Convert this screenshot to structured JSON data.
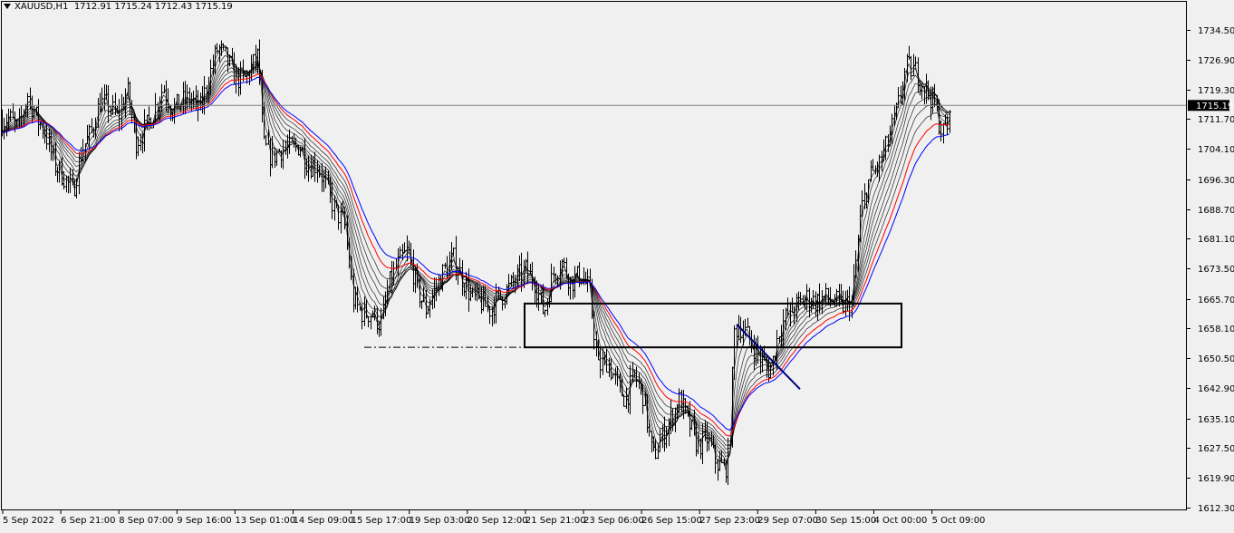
{
  "header": {
    "symbol_timeframe": "XAUUSD,H1",
    "ohlc": "1712.91 1715.24 1712.43 1715.19"
  },
  "chart_data": {
    "type": "line",
    "title": "XAUUSD,H1",
    "xlabel": "",
    "ylabel": "",
    "ylim": [
      1612.32,
      1740.68
    ],
    "grid": false,
    "current_price": "1715.19",
    "colors": {
      "bars": "#000000",
      "ema_fast": "#000000",
      "ema_mid": "#ff0000",
      "ema_slow": "#0000ff",
      "price_line": "#808080",
      "background": "#f0f0f0"
    },
    "y_ticks": [
      "1734.50",
      "1726.90",
      "1719.30",
      "1711.70",
      "1704.10",
      "1696.30",
      "1688.70",
      "1681.10",
      "1673.50",
      "1665.70",
      "1658.10",
      "1650.50",
      "1642.90",
      "1635.10",
      "1627.50",
      "1619.90",
      "1612.30"
    ],
    "x_ticks": [
      "5 Sep 2022",
      "6 Sep 21:00",
      "8 Sep 07:00",
      "9 Sep 16:00",
      "13 Sep 01:00",
      "14 Sep 09:00",
      "15 Sep 17:00",
      "19 Sep 03:00",
      "20 Sep 12:00",
      "21 Sep 21:00",
      "23 Sep 06:00",
      "26 Sep 15:00",
      "27 Sep 23:00",
      "29 Sep 07:00",
      "30 Sep 15:00",
      "4 Oct 00:00",
      "5 Oct 09:00"
    ],
    "price_path": [
      [
        0,
        1711
      ],
      [
        10,
        1712
      ],
      [
        20,
        1709
      ],
      [
        30,
        1718
      ],
      [
        40,
        1712
      ],
      [
        50,
        1708
      ],
      [
        60,
        1700
      ],
      [
        70,
        1697
      ],
      [
        80,
        1693
      ],
      [
        90,
        1704
      ],
      [
        100,
        1708
      ],
      [
        110,
        1716
      ],
      [
        120,
        1715
      ],
      [
        130,
        1712
      ],
      [
        140,
        1719
      ],
      [
        150,
        1706
      ],
      [
        160,
        1709
      ],
      [
        170,
        1714
      ],
      [
        180,
        1720
      ],
      [
        190,
        1714
      ],
      [
        200,
        1716
      ],
      [
        210,
        1717
      ],
      [
        220,
        1714
      ],
      [
        230,
        1722
      ],
      [
        240,
        1730
      ],
      [
        250,
        1727
      ],
      [
        260,
        1722
      ],
      [
        270,
        1722
      ],
      [
        280,
        1726
      ],
      [
        285,
        1728
      ],
      [
        290,
        1705
      ],
      [
        300,
        1702
      ],
      [
        310,
        1704
      ],
      [
        320,
        1704
      ],
      [
        330,
        1705
      ],
      [
        340,
        1700
      ],
      [
        350,
        1700
      ],
      [
        360,
        1694
      ],
      [
        370,
        1688
      ],
      [
        380,
        1685
      ],
      [
        390,
        1665
      ],
      [
        400,
        1662
      ],
      [
        410,
        1662
      ],
      [
        420,
        1659
      ],
      [
        430,
        1670
      ],
      [
        440,
        1675
      ],
      [
        450,
        1678
      ],
      [
        460,
        1668
      ],
      [
        470,
        1663
      ],
      [
        480,
        1668
      ],
      [
        490,
        1673
      ],
      [
        500,
        1676
      ],
      [
        510,
        1671
      ],
      [
        520,
        1666
      ],
      [
        530,
        1665
      ],
      [
        540,
        1663
      ],
      [
        550,
        1666
      ],
      [
        560,
        1668
      ],
      [
        570,
        1671
      ],
      [
        580,
        1673
      ],
      [
        590,
        1670
      ],
      [
        600,
        1662
      ],
      [
        610,
        1672
      ],
      [
        620,
        1675
      ],
      [
        630,
        1670
      ],
      [
        640,
        1672
      ],
      [
        650,
        1668
      ],
      [
        660,
        1648
      ],
      [
        670,
        1650
      ],
      [
        680,
        1644
      ],
      [
        690,
        1640
      ],
      [
        700,
        1646
      ],
      [
        710,
        1641
      ],
      [
        720,
        1625
      ],
      [
        730,
        1630
      ],
      [
        740,
        1635
      ],
      [
        750,
        1640
      ],
      [
        760,
        1634
      ],
      [
        770,
        1628
      ],
      [
        780,
        1630
      ],
      [
        790,
        1624
      ],
      [
        800,
        1622
      ],
      [
        805,
        1627
      ],
      [
        810,
        1657
      ],
      [
        815,
        1659
      ],
      [
        820,
        1658
      ],
      [
        830,
        1654
      ],
      [
        840,
        1650
      ],
      [
        850,
        1647
      ],
      [
        860,
        1658
      ],
      [
        870,
        1662
      ],
      [
        880,
        1664
      ],
      [
        890,
        1666
      ],
      [
        900,
        1665
      ],
      [
        910,
        1666
      ],
      [
        920,
        1665
      ],
      [
        930,
        1664
      ],
      [
        940,
        1665
      ],
      [
        950,
        1688
      ],
      [
        960,
        1697
      ],
      [
        970,
        1700
      ],
      [
        980,
        1706
      ],
      [
        990,
        1714
      ],
      [
        1000,
        1725
      ],
      [
        1010,
        1724
      ],
      [
        1020,
        1720
      ],
      [
        1030,
        1716
      ],
      [
        1040,
        1708
      ],
      [
        1050,
        1712
      ]
    ],
    "annotations": [
      {
        "type": "rectangle",
        "x_range": [
          "21 Sep 21:00",
          "4 Oct 00:00"
        ],
        "price_range": [
          1653.3,
          1664.5
        ]
      },
      {
        "type": "dash-dot line",
        "price": 1653.3
      },
      {
        "type": "trendline",
        "color": "#000080"
      }
    ]
  }
}
